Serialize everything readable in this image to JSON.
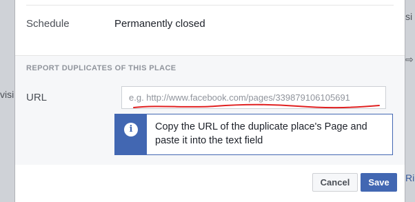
{
  "background": {
    "left_text": "visi",
    "right_text_top": "si",
    "right_text_bottom": "Ri",
    "right_arrow": "⇨"
  },
  "dialog": {
    "schedule": {
      "label": "Schedule",
      "value": "Permanently closed"
    },
    "duplicates": {
      "header": "REPORT DUPLICATES OF THIS PLACE",
      "url_label": "URL",
      "url_placeholder": "e.g. http://www.facebook.com/pages/339879106105691",
      "url_value": "",
      "info_icon_glyph": "i",
      "info_text": "Copy the URL of the duplicate place's Page and paste it into the text field"
    },
    "buttons": {
      "cancel": "Cancel",
      "save": "Save"
    }
  },
  "icons": {
    "info": "info-circle-icon",
    "annotation": "red-underline-scribble"
  },
  "colors": {
    "accent": "#4267b2",
    "annotation": "#e02020",
    "section_bg": "#f6f7f9"
  }
}
